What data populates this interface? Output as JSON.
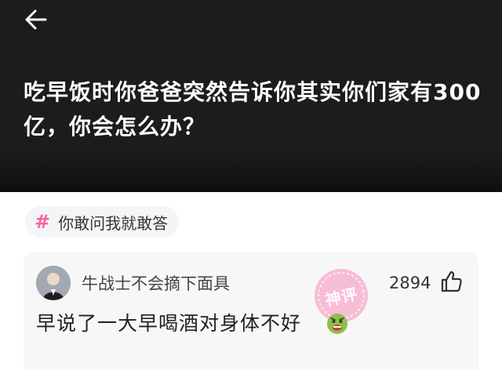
{
  "header": {
    "back_icon": "arrow-left-icon",
    "question": "吃早饭时你爸爸突然告诉你其实你们家有300亿，你会怎么办？"
  },
  "topic": {
    "icon": "hash-icon",
    "hash": "#",
    "label": "你敢问我就敢答"
  },
  "comment": {
    "author": "牛战士不会摘下面具",
    "likes": "2894",
    "like_icon": "thumbs-up-icon",
    "text": "早说了一大早喝酒对身体不好",
    "emoji_icon": "sick-face-emoji-icon",
    "badge": "神评"
  },
  "colors": {
    "header_bg": "#1c1c1e",
    "accent": "#ff5fa2",
    "card_bg": "#f7f7f8"
  }
}
